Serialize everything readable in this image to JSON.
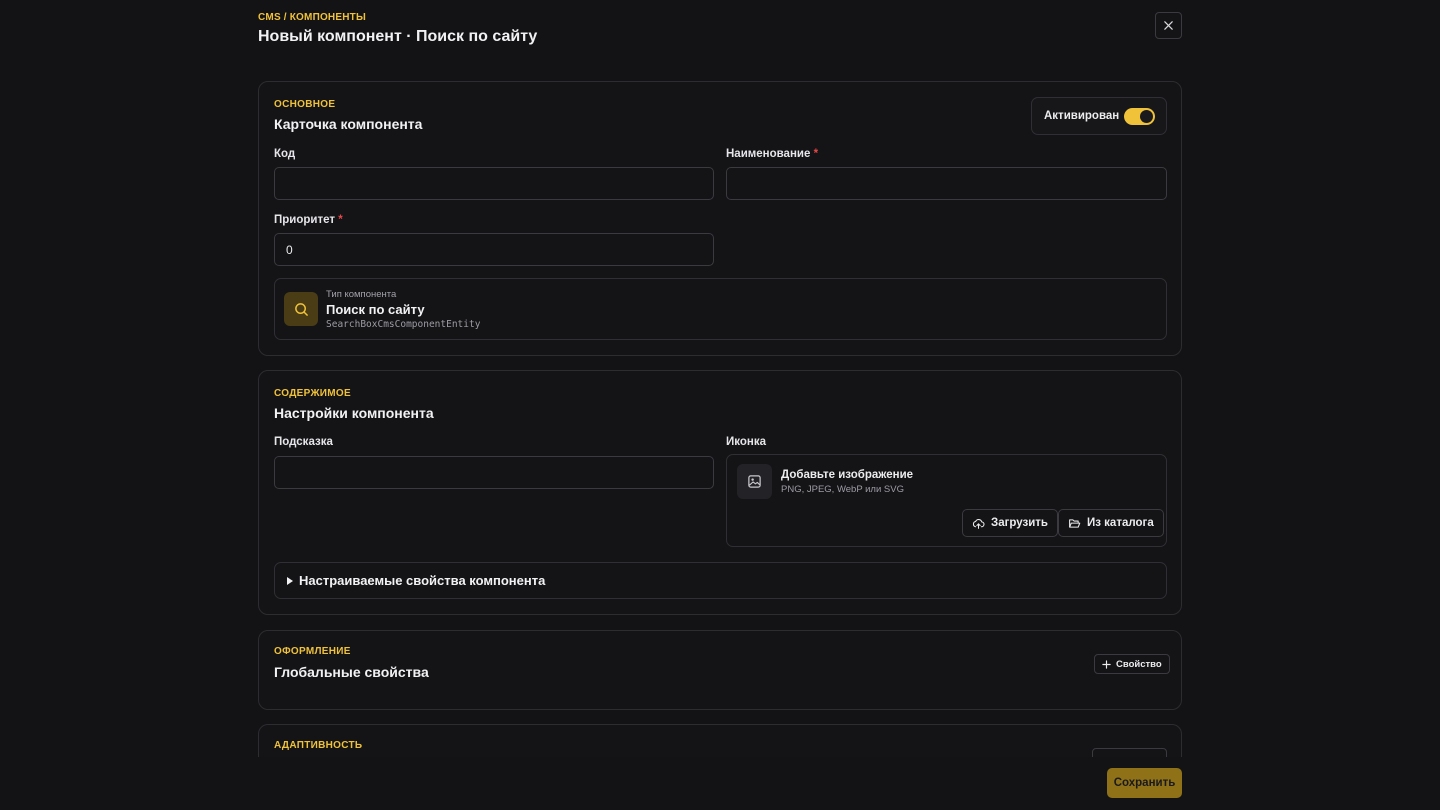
{
  "header": {
    "breadcrumb": "CMS / КОМПОНЕНТЫ",
    "title": "Новый компонент · Поиск по сайту"
  },
  "basic": {
    "section_label": "ОСНОВНОЕ",
    "title": "Карточка компонента",
    "toggle_label": "Активирован",
    "toggle_on": true,
    "code_label": "Код",
    "code_value": "",
    "name_label": "Наименование",
    "name_value": "",
    "priority_label": "Приоритет",
    "priority_value": "0",
    "required_mark": "*",
    "type": {
      "label": "Тип компонента",
      "name": "Поиск по сайту",
      "class": "SearchBoxCmsComponentEntity",
      "icon": "search-icon"
    }
  },
  "content": {
    "section_label": "СОДЕРЖИМОЕ",
    "title": "Настройки компонента",
    "hint_label": "Подсказка",
    "hint_value": "",
    "icon_label": "Иконка",
    "image": {
      "title": "Добавьте изображение",
      "formats": "PNG, JPEG, WebP или SVG",
      "upload_label": "Загрузить",
      "catalog_label": "Из каталога"
    },
    "custom_props_label": "Настраиваемые свойства компонента"
  },
  "design": {
    "section_label": "ОФОРМЛЕНИЕ",
    "title": "Глобальные свойства",
    "add_property_label": "Свойство"
  },
  "adaptive": {
    "section_label": "АДАПТИВНОСТЬ"
  },
  "footer": {
    "save_label": "Сохранить"
  },
  "colors": {
    "accent": "#f0c23a",
    "background": "#131316",
    "required": "#e54848",
    "save_button": "#8f7118"
  }
}
